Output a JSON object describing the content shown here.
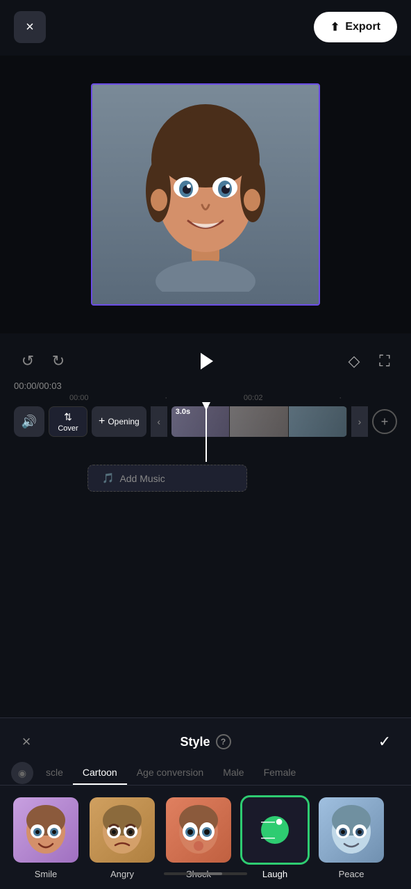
{
  "header": {
    "close_label": "×",
    "export_label": "Export",
    "export_icon": "↑"
  },
  "playback": {
    "time_current": "00:00",
    "time_total": "00:03",
    "timeline_marker_1": "00:00",
    "timeline_marker_2": "00:02",
    "undo_label": "↺",
    "redo_label": "↻"
  },
  "tracks": {
    "track_duration": "3.0s",
    "cover_label": "Cover",
    "opening_label": "Opening",
    "add_music_label": "Add Music"
  },
  "style_panel": {
    "title": "Style",
    "close_label": "×",
    "confirm_label": "✓",
    "help_icon": "?",
    "tabs": [
      {
        "id": "muscle",
        "label": "scle",
        "active": false
      },
      {
        "id": "cartoon",
        "label": "Cartoon",
        "active": true
      },
      {
        "id": "age_conversion",
        "label": "Age conversion",
        "active": false
      },
      {
        "id": "male",
        "label": "Male",
        "active": false
      },
      {
        "id": "female",
        "label": "Female",
        "active": false
      }
    ],
    "items": [
      {
        "id": "smile",
        "label": "Smile",
        "selected": false
      },
      {
        "id": "angry",
        "label": "Angry",
        "selected": false
      },
      {
        "id": "shock",
        "label": "Shock",
        "selected": false
      },
      {
        "id": "laugh",
        "label": "Laugh",
        "selected": true
      },
      {
        "id": "peace",
        "label": "Peace",
        "selected": false
      }
    ]
  }
}
